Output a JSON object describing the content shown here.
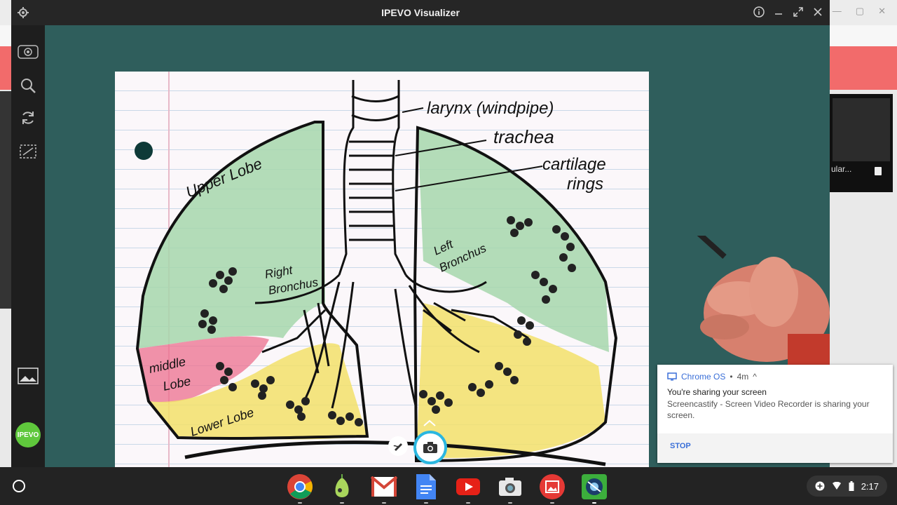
{
  "window": {
    "title": "IPEVO Visualizer"
  },
  "background_app": {
    "panel_label": "ular..."
  },
  "toolbar": {
    "brand": "IPEVO"
  },
  "diagram": {
    "labels": {
      "larynx": "larynx (windpipe)",
      "trachea": "trachea",
      "cartilage": "cartilage",
      "rings": "rings",
      "upper_lobe": "Upper Lobe",
      "right_bronchus_1": "Right",
      "right_bronchus_2": "Bronchus",
      "left_bronchus_1": "Left",
      "left_bronchus_2": "Bronchus",
      "middle_lobe_1": "middle",
      "middle_lobe_2": "Lobe",
      "lower_lobe": "Lower Lobe"
    },
    "colors": {
      "green": "#9fd3a6",
      "pink": "#ec6f8e",
      "yellow": "#f2e06a"
    }
  },
  "notification": {
    "source": "Chrome OS",
    "age": "4m",
    "title": "You're sharing your screen",
    "body": "Screencastify - Screen Video Recorder is sharing your screen.",
    "action": "STOP"
  },
  "shelf": {
    "apps": [
      "chrome",
      "pear-deck",
      "gmail",
      "docs",
      "youtube",
      "camera",
      "gallery",
      "ipevo-visualizer"
    ],
    "time": "2:17"
  }
}
